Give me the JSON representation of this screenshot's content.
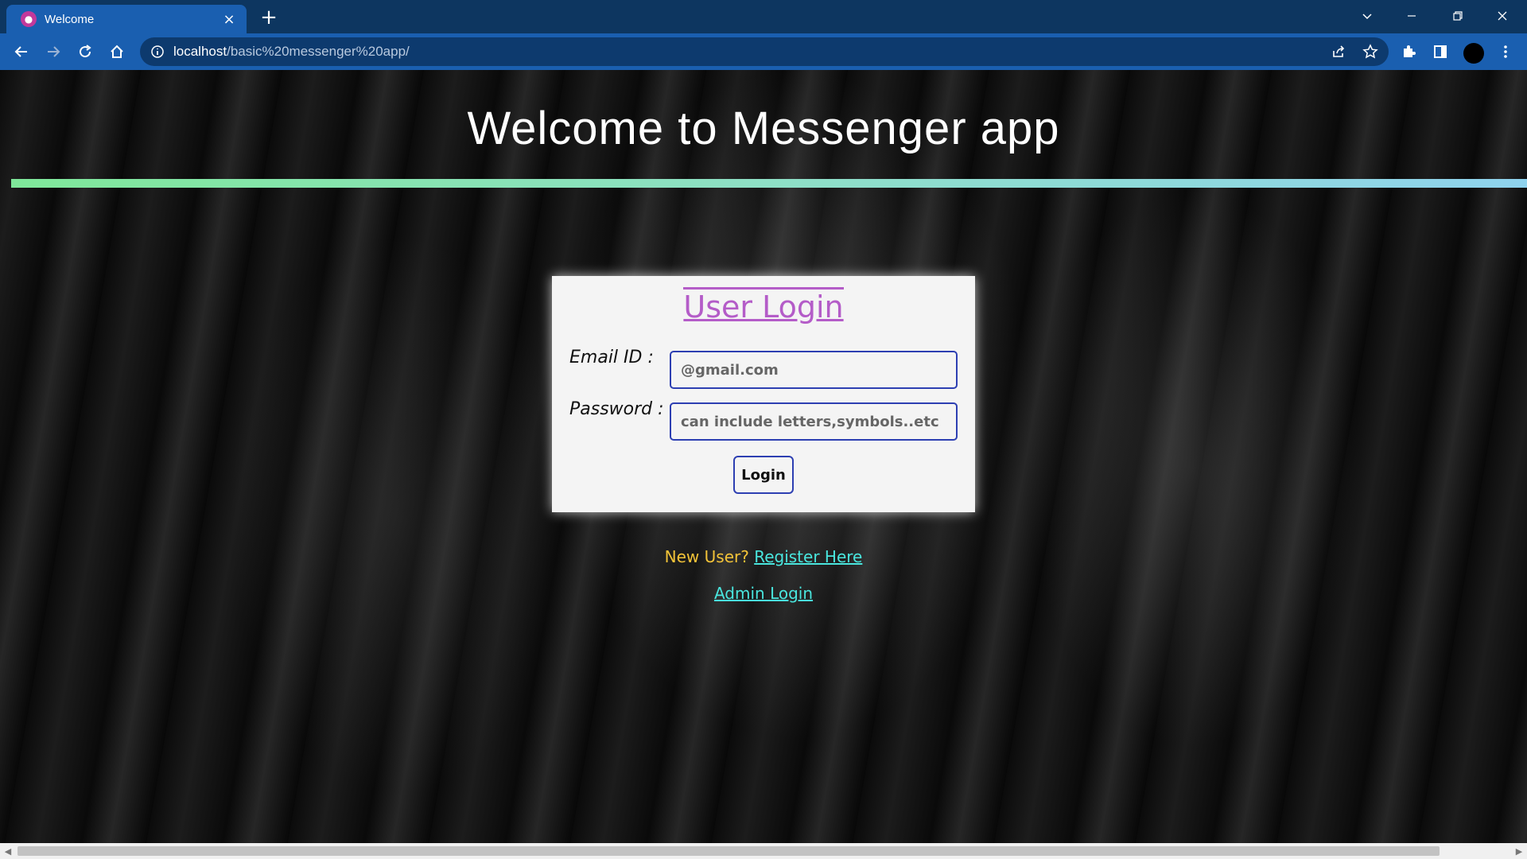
{
  "browser": {
    "tab": {
      "title": "Welcome",
      "favicon": "messenger-favicon-icon",
      "close": "×"
    },
    "new_tab": "+",
    "url": {
      "host": "localhost",
      "path": "/basic%20messenger%20app/"
    }
  },
  "page": {
    "title": "Welcome to Messenger app",
    "login": {
      "heading": "User Login",
      "email_label": "Email ID :",
      "email_placeholder": "@gmail.com",
      "password_label": "Password :",
      "password_placeholder": "can include letters,symbols..etc",
      "button": "Login"
    },
    "register_prefix": "New User?",
    "register_link": "Register Here",
    "admin_link": "Admin Login"
  },
  "colors": {
    "tabbar": "#0d3660",
    "toolbar": "#1a5fb0",
    "heading_purple": "#b45cc8",
    "link_cyan": "#49e6de",
    "prefix_yellow": "#f3c338",
    "input_border": "#2d3fb2"
  }
}
